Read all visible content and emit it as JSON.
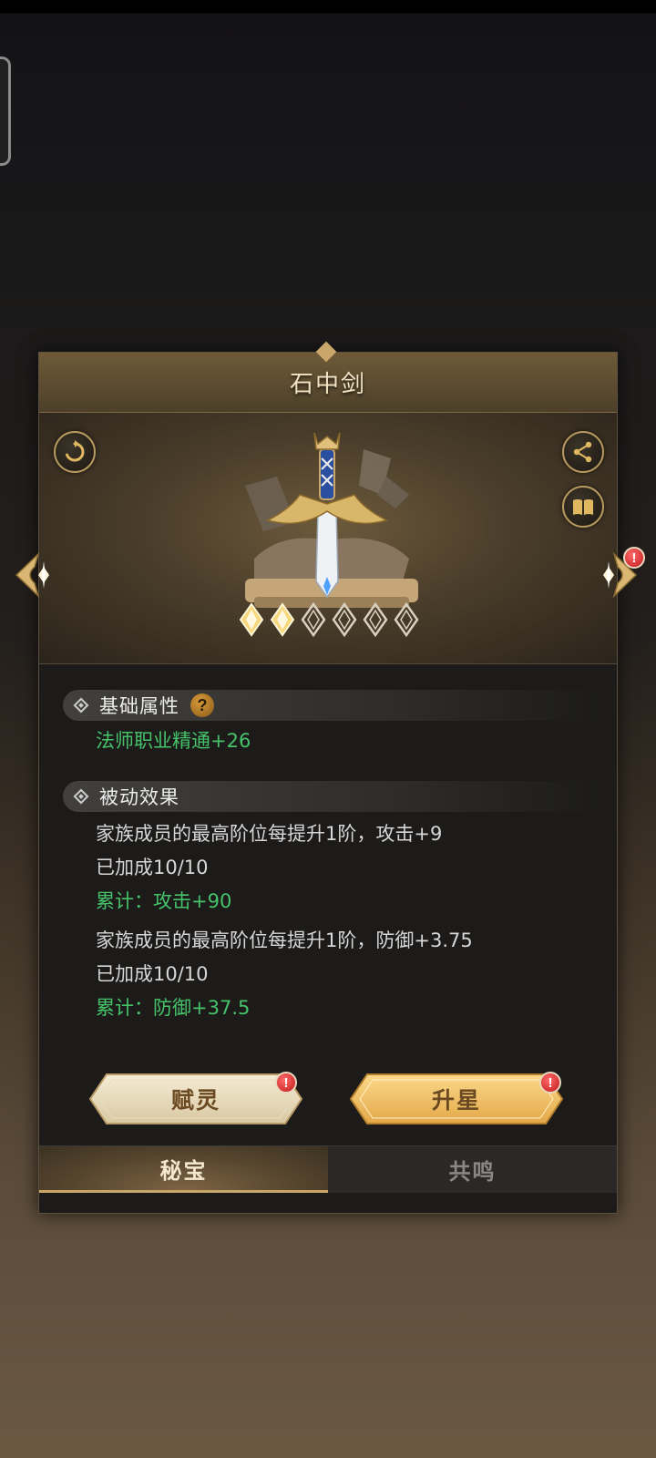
{
  "artifact": {
    "name": "石中剑",
    "stars_total": 6,
    "stars_filled": 2
  },
  "sections": {
    "basic": {
      "title": "基础属性",
      "help_icon_label": "?",
      "stat": "法师职业精通+26"
    },
    "passive": {
      "title": "被动效果",
      "effects": [
        {
          "desc": "家族成员的最高阶位每提升1阶，攻击+9",
          "progress": "已加成10/10",
          "total": "累计：攻击+90"
        },
        {
          "desc": "家族成员的最高阶位每提升1阶，防御+3.75",
          "progress": "已加成10/10",
          "total": "累计：防御+37.5"
        }
      ]
    }
  },
  "buttons": {
    "enchant": "赋灵",
    "star_up": "升星",
    "alert_mark": "!"
  },
  "tabs": [
    {
      "label": "秘宝",
      "active": true
    },
    {
      "label": "共鸣",
      "active": false
    }
  ],
  "colors": {
    "positive_green": "#46c36a",
    "gold_accent": "#c9a76a",
    "alert_red": "#d42020"
  },
  "icons": [
    "refresh-icon",
    "share-icon",
    "book-icon",
    "arrow-left-icon",
    "arrow-right-icon",
    "star-diamond-icon",
    "help-icon",
    "alert-icon"
  ]
}
